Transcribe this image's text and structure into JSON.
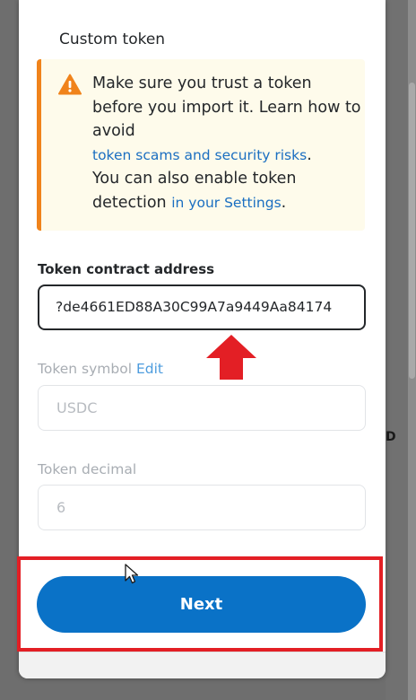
{
  "background": {
    "partial_text": "D"
  },
  "popup": {
    "section_title": "Custom token",
    "warning": {
      "line_1": "Make sure you trust a token before you import it. Learn how to avoid",
      "link_1": "token scams and security risks",
      "after_link_1": ".",
      "line_2": "You can also enable token detection",
      "link_2": "in your Settings",
      "after_link_2": ".",
      "icon": "warning-triangle-icon",
      "accent_color": "#f0831b"
    },
    "contract_address": {
      "label": "Token contract address",
      "value": "?de4661ED88A30C99A7a9449Aa84174"
    },
    "token_symbol": {
      "label": "Token symbol",
      "edit_label": "Edit",
      "placeholder": "USDC"
    },
    "token_decimal": {
      "label": "Token decimal",
      "placeholder": "6"
    },
    "next_button": {
      "label": "Next",
      "color": "#0a72c7"
    }
  },
  "annotations": {
    "arrow_color": "#e31f25",
    "highlight_color": "#e31f25"
  }
}
